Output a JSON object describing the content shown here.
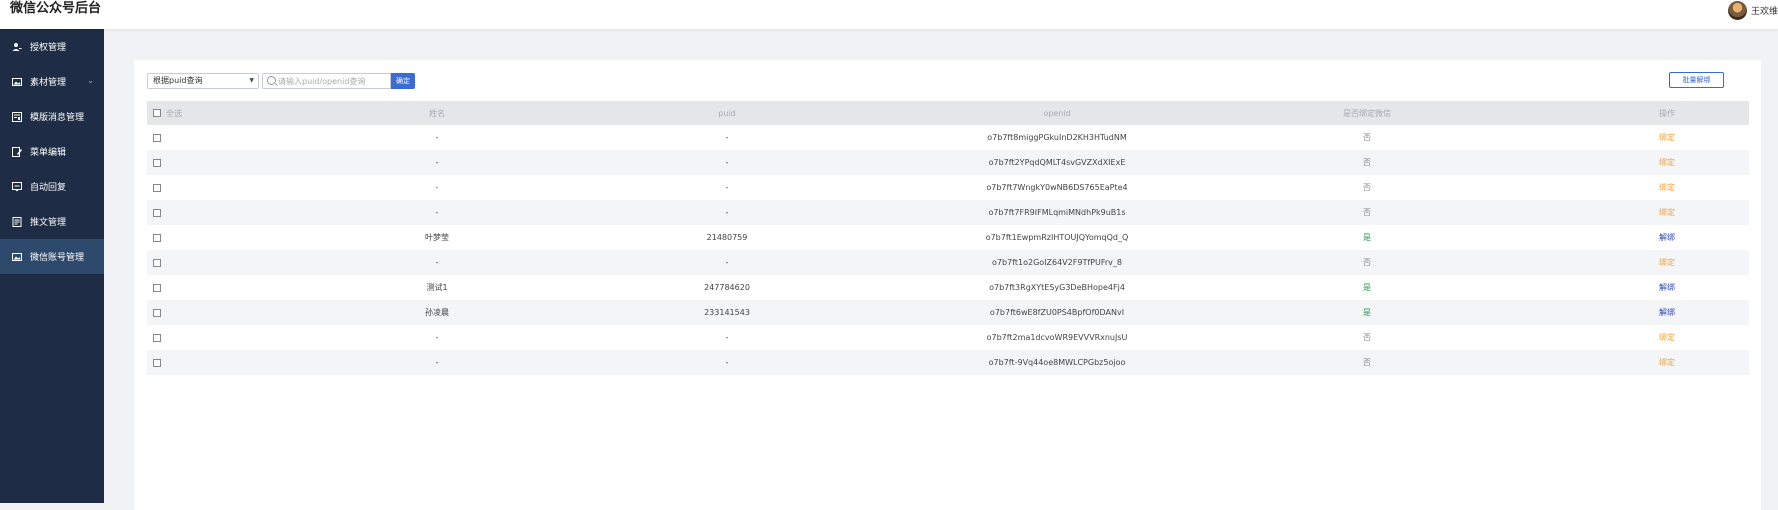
{
  "app": {
    "title": "微信公众号后台"
  },
  "user": {
    "name": "王欢维"
  },
  "sidebar": {
    "items": [
      {
        "label": "授权管理",
        "icon": "user-key-icon"
      },
      {
        "label": "素材管理",
        "icon": "image-icon",
        "expandable": true
      },
      {
        "label": "模版消息管理",
        "icon": "template-icon"
      },
      {
        "label": "菜单编辑",
        "icon": "edit-icon"
      },
      {
        "label": "自动回复",
        "icon": "reply-icon"
      },
      {
        "label": "推文管理",
        "icon": "article-icon"
      },
      {
        "label": "微信账号管理",
        "icon": "image-icon",
        "active": true
      }
    ]
  },
  "toolbar": {
    "query_mode": "根据puid查询",
    "search_placeholder": "请输入puid/openid查询",
    "confirm_label": "确定",
    "batch_unbind_label": "批量解绑"
  },
  "table": {
    "headers": {
      "select_all": "全选",
      "name": "姓名",
      "puid": "puid",
      "openid": "openid",
      "bound": "是否绑定微信",
      "operation": "操作"
    },
    "rows": [
      {
        "name": "-",
        "puid": "-",
        "openid": "o7b7ft8miggPGkuInD2KH3HTudNM",
        "bound": "否",
        "operation": "绑定"
      },
      {
        "name": "-",
        "puid": "-",
        "openid": "o7b7ft2YPqdQMLT4svGVZXdXIExE",
        "bound": "否",
        "operation": "绑定"
      },
      {
        "name": "-",
        "puid": "-",
        "openid": "o7b7ft7WngkY0wNB6DS765EaPte4",
        "bound": "否",
        "operation": "绑定"
      },
      {
        "name": "-",
        "puid": "-",
        "openid": "o7b7ft7FR9IFMLqmiMNdhPk9uB1s",
        "bound": "否",
        "operation": "绑定"
      },
      {
        "name": "叶梦莹",
        "puid": "21480759",
        "openid": "o7b7ft1EwpmRzIHTOUJQYomqQd_Q",
        "bound": "是",
        "operation": "解绑"
      },
      {
        "name": "-",
        "puid": "-",
        "openid": "o7b7ft1o2GoIZ64V2F9TfPUFrv_8",
        "bound": "否",
        "operation": "绑定"
      },
      {
        "name": "测试1",
        "puid": "247784620",
        "openid": "o7b7ft3RgXYtESyG3DeBHope4Fj4",
        "bound": "是",
        "operation": "解绑"
      },
      {
        "name": "孙凌晨",
        "puid": "233141543",
        "openid": "o7b7ft6wE8fZU0PS4BpfOf0DANvI",
        "bound": "是",
        "operation": "解绑"
      },
      {
        "name": "-",
        "puid": "-",
        "openid": "o7b7ft2ma1dcvoWR9EVVVRxnuJsU",
        "bound": "否",
        "operation": "绑定"
      },
      {
        "name": "-",
        "puid": "-",
        "openid": "o7b7ft-9Vq44oe8MWLCPGbz5ojoo",
        "bound": "否",
        "operation": "绑定"
      }
    ]
  }
}
